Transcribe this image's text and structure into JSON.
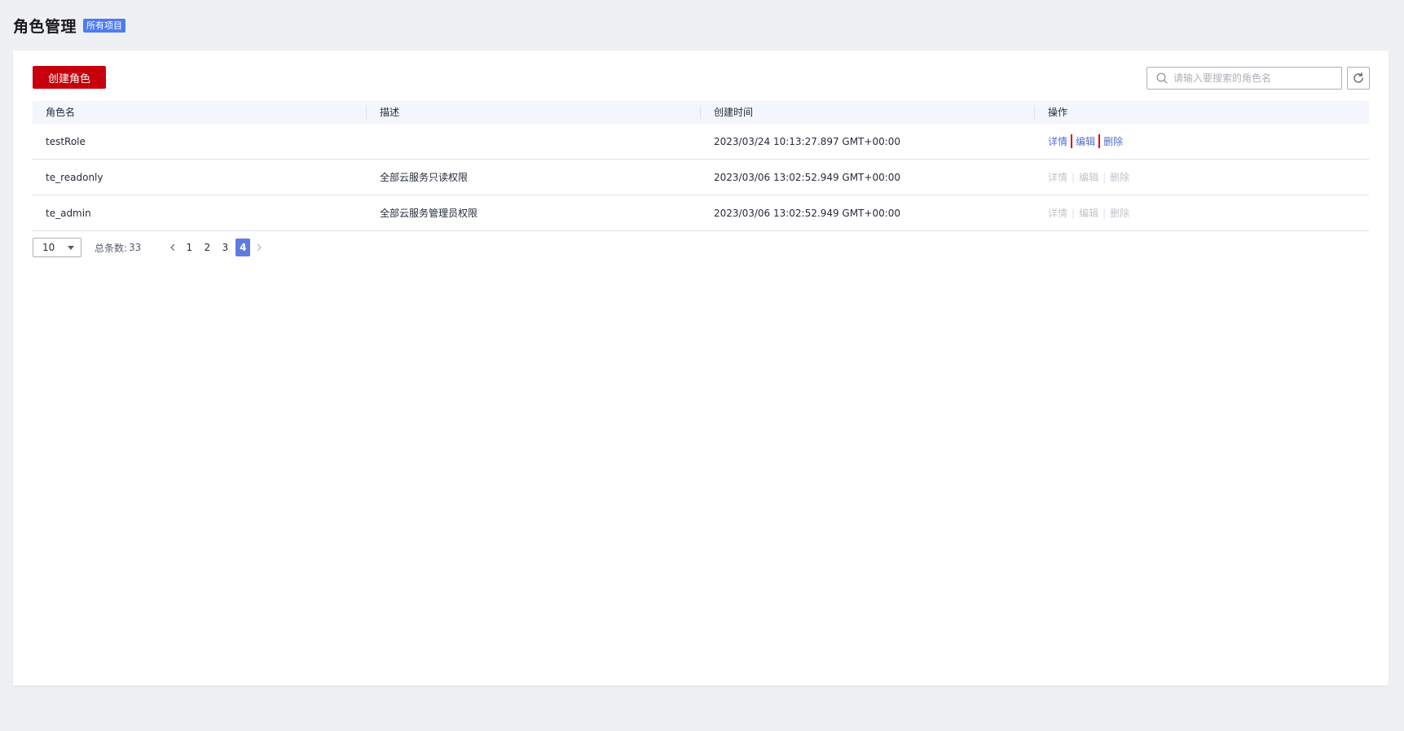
{
  "header": {
    "title": "角色管理",
    "project_badge": "所有项目"
  },
  "toolbar": {
    "create_label": "创建角色",
    "search_placeholder": "请输入要搜索的角色名",
    "search_value": ""
  },
  "table": {
    "columns": [
      "角色名",
      "描述",
      "创建时间",
      "操作"
    ],
    "rows": [
      {
        "name": "testRole",
        "description": "",
        "created": "2023/03/24 10:13:27.897 GMT+00:00",
        "actions_enabled": true
      },
      {
        "name": "te_readonly",
        "description": "全部云服务只读权限",
        "created": "2023/03/06 13:02:52.949 GMT+00:00",
        "actions_enabled": false
      },
      {
        "name": "te_admin",
        "description": "全部云服务管理员权限",
        "created": "2023/03/06 13:02:52.949 GMT+00:00",
        "actions_enabled": false
      }
    ],
    "actions": {
      "detail": "详情",
      "edit": "编辑",
      "delete": "删除",
      "separator": "|"
    }
  },
  "pagination": {
    "page_size": "10",
    "total_label": "总条数:",
    "total_value": "33",
    "pages": [
      "1",
      "2",
      "3",
      "4"
    ],
    "current_page": "4"
  },
  "colors": {
    "primary_button": "#c7000b",
    "link": "#526ecc",
    "disabled_link": "#c0c4cc",
    "badge": "#4d7cf2",
    "active_page": "#5e7ce0",
    "highlight_box": "#e3000f"
  },
  "icons": {
    "search": "search-icon",
    "refresh": "refresh-icon",
    "dropdown": "caret-down-icon",
    "prev": "chevron-left-icon",
    "next": "chevron-right-icon"
  }
}
